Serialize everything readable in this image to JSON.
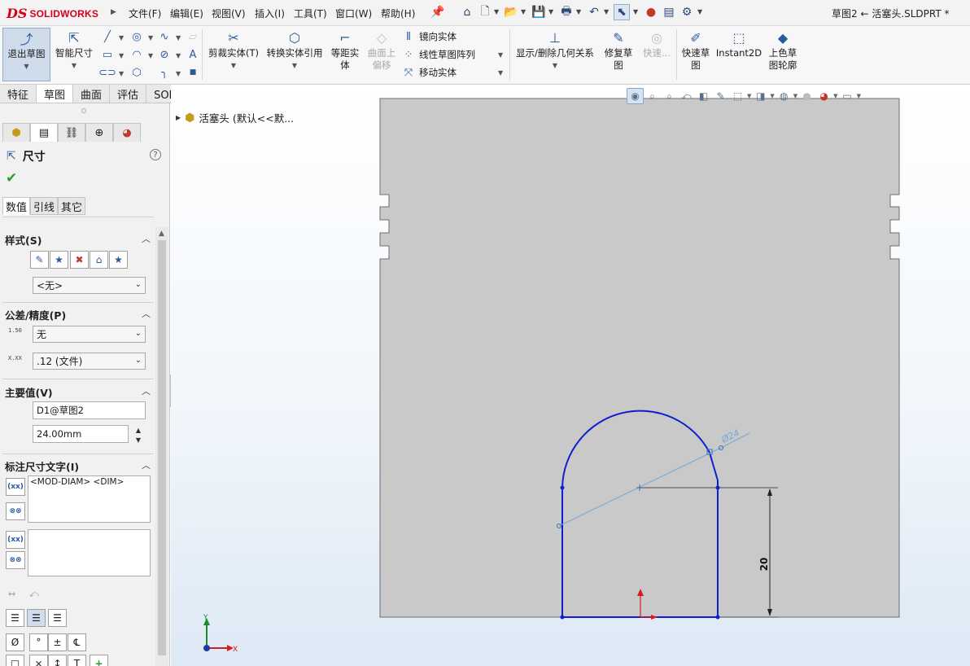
{
  "app": {
    "brand": "SOLIDWORKS",
    "brand_prefix": "DS",
    "document_title": "草图2 ← 活塞头.SLDPRT *"
  },
  "menu": {
    "items": [
      "文件(F)",
      "编辑(E)",
      "视图(V)",
      "插入(I)",
      "工具(T)",
      "窗口(W)",
      "帮助(H)"
    ]
  },
  "quick_access_icons": [
    "pin-icon",
    "home-icon",
    "new-document-icon",
    "open-icon",
    "save-icon",
    "print-icon",
    "undo-icon",
    "select-icon",
    "traffic-light-icon",
    "file-properties-icon",
    "gear-icon"
  ],
  "commands": {
    "exit_sketch": "退出草图",
    "smart_dimension": "智能尺寸",
    "trim": "剪裁实体(T)",
    "convert": "转换实体引用",
    "offset": "等距实体",
    "surface_offset": "曲面上偏移",
    "mirror": "镜向实体",
    "linear_pattern": "线性草图阵列",
    "move": "移动实体",
    "display_delete_relations": "显示/删除几何关系",
    "repair_sketch": "修复草图",
    "quick_snaps": "快速...",
    "rapid_sketch": "快速草图",
    "instant2d": "Instant2D",
    "shaded_contours": "上色草图轮廓"
  },
  "tabs": [
    {
      "label": "特征",
      "active": false
    },
    {
      "label": "草图",
      "active": true
    },
    {
      "label": "曲面",
      "active": false
    },
    {
      "label": "评估",
      "active": false
    },
    {
      "label": "SOLIDWORKS 插件",
      "active": false
    }
  ],
  "property_manager": {
    "title": "尺寸",
    "help": "?",
    "ok_symbol": "✔",
    "sub_tabs": [
      {
        "label": "数值",
        "active": true
      },
      {
        "label": "引线",
        "active": false
      },
      {
        "label": "其它",
        "active": false
      }
    ],
    "style_section": {
      "title": "样式(S)",
      "dropdown_value": "<无>"
    },
    "tolerance_section": {
      "title": "公差/精度(P)",
      "tolerance_icon_text": "1.50",
      "tolerance_value": "无",
      "precision_icon_text": "X.XX",
      "precision_value": ".12 (文件)"
    },
    "primary_value_section": {
      "title": "主要值(V)",
      "name": "D1@草图2",
      "value": "24.00mm"
    },
    "dimension_text_section": {
      "title": "标注尺寸文字(I)",
      "text": "<MOD-DIAM> <DIM>",
      "lower_text": ""
    },
    "symbols": [
      "Ø",
      "°",
      "±",
      "℄"
    ],
    "symbols_row2": [
      "□",
      "⨯",
      "↕",
      "T",
      "+"
    ]
  },
  "feature_tree": {
    "root_label": "活塞头  (默认<<默..."
  },
  "sketch": {
    "diameter_label": "Ø24",
    "height_label": "20"
  },
  "triad": {
    "x_label": "X",
    "y_label": "Y"
  },
  "colors": {
    "sketch_blue": "#0f1fd0",
    "dim_line": "#4a4a4a",
    "diameter_dim": "#6fa8dc",
    "part_gray": "#c8c8c8",
    "origin_red": "#d41e1e",
    "triad_green": "#1a8a2a",
    "accent_selected": "#cfdcec"
  }
}
